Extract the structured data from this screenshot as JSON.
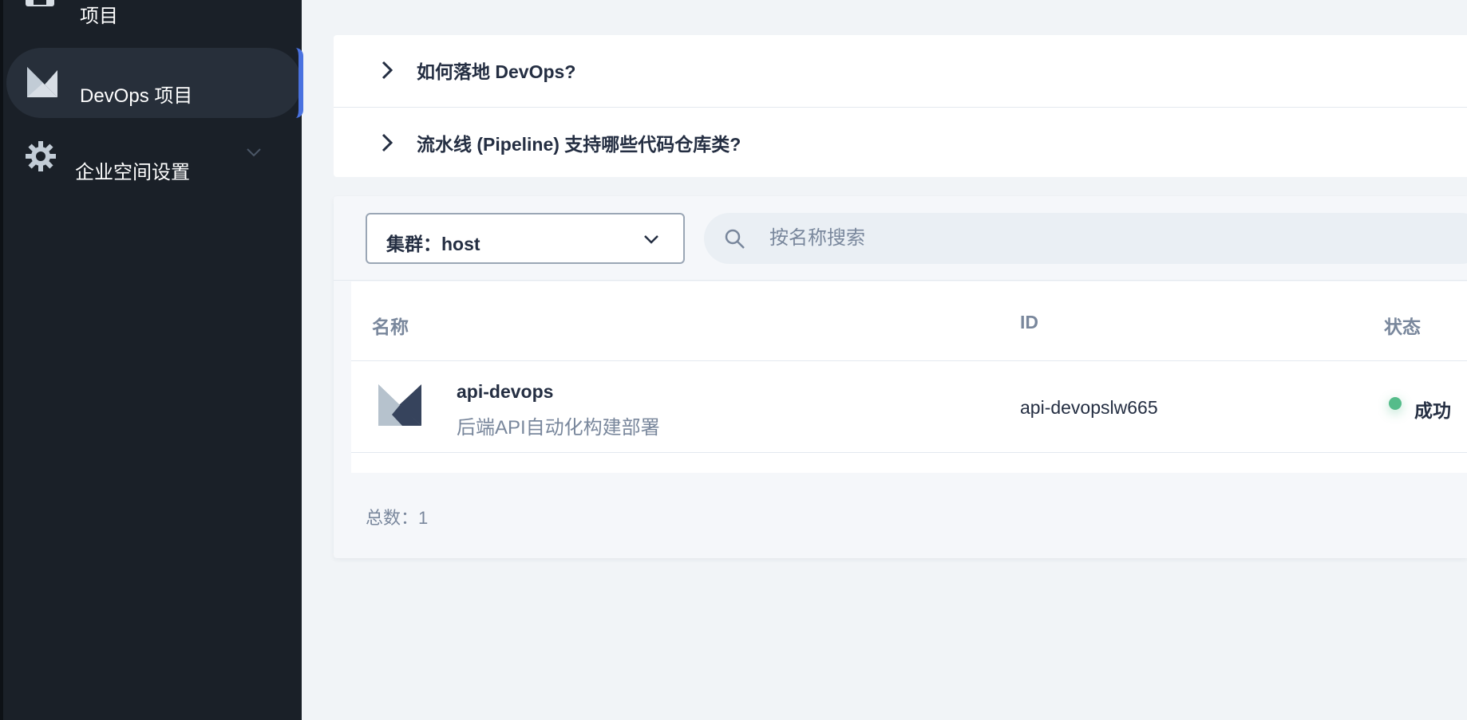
{
  "sidebar": {
    "items": [
      {
        "label": "项目",
        "icon": "project-icon"
      },
      {
        "label": "DevOps 项目",
        "icon": "devops-icon",
        "active": true
      },
      {
        "label": "企业空间设置",
        "icon": "gear-icon",
        "expandable": true
      }
    ]
  },
  "faq": [
    {
      "question": "如何落地 DevOps?"
    },
    {
      "question": "流水线 (Pipeline) 支持哪些代码仓库类?"
    }
  ],
  "toolbar": {
    "cluster_label": "集群：host",
    "search_placeholder": "按名称搜索"
  },
  "table": {
    "columns": [
      "名称",
      "ID",
      "状态"
    ],
    "rows": [
      {
        "name": "api-devops",
        "description": "后端API自动化构建部署",
        "id": "api-devopslw665",
        "status": "成功"
      }
    ]
  },
  "footer": {
    "total": "总数：1"
  },
  "colors": {
    "sidebar_bg": "#1a2028",
    "active_accent": "#4a72e0",
    "success": "#55bc8a",
    "text_primary": "#242e42",
    "text_secondary": "#79879c"
  }
}
